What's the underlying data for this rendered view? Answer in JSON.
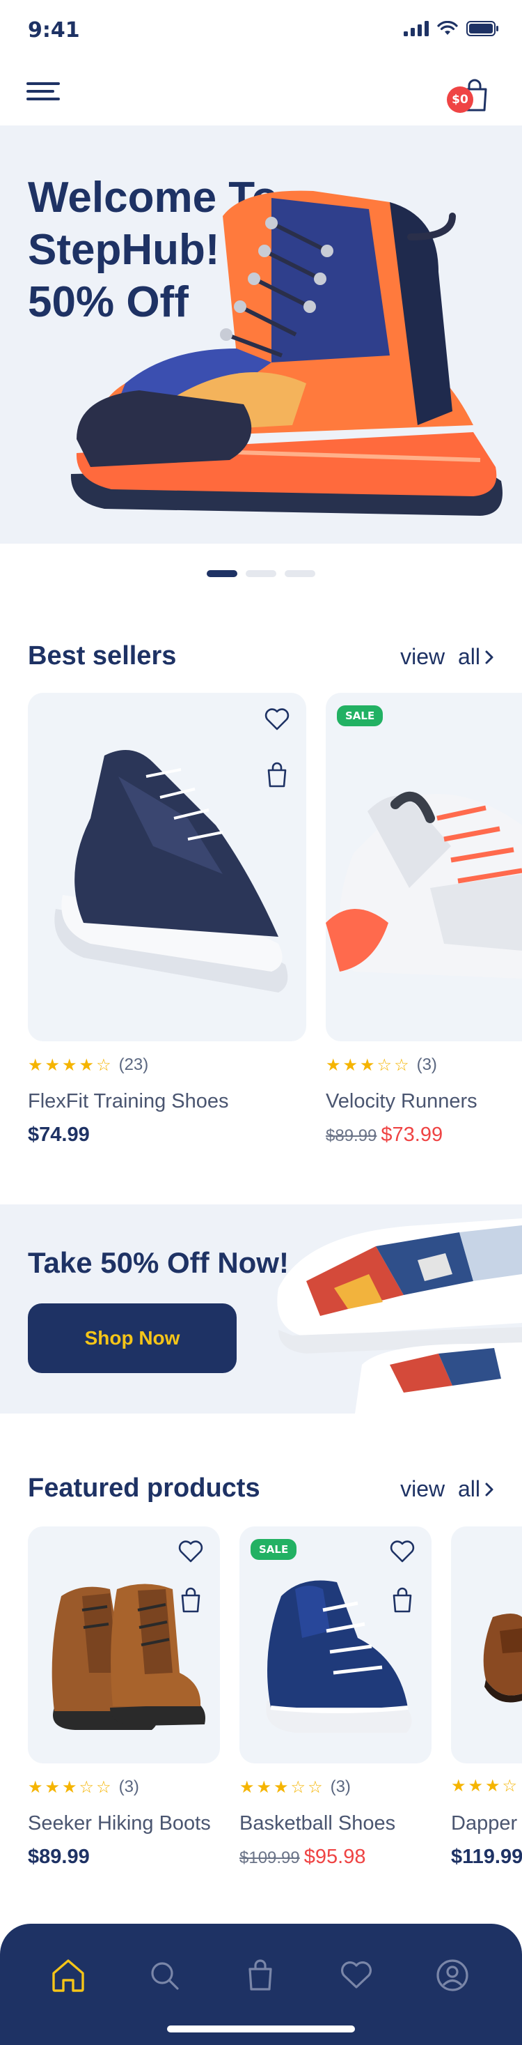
{
  "status_bar": {
    "time": "9:41"
  },
  "header": {
    "cart_count": "$0"
  },
  "hero": {
    "title_lines": [
      "Welcome To",
      "StepHub!",
      "50% Off"
    ],
    "slides": 3,
    "active_slide": 1
  },
  "best_sellers": {
    "title": "Best sellers",
    "view_all": "view all",
    "products": [
      {
        "name": "FlexFit Training Shoes",
        "price": "$74.99",
        "rating": 4,
        "rating_count": "(23)",
        "sale": false
      },
      {
        "name": "Velocity Runners",
        "old_price": "$89.99",
        "price": "$73.99",
        "rating": 3,
        "rating_count": "(3)",
        "sale": true,
        "sale_label": "SALE"
      }
    ]
  },
  "promo": {
    "title": "Take 50% Off Now!",
    "button": "Shop Now"
  },
  "featured": {
    "title": "Featured products",
    "view_all": "view all",
    "products": [
      {
        "name": "Seeker Hiking Boots",
        "price": "$89.99",
        "rating": 3,
        "rating_count": "(3)",
        "sale": false
      },
      {
        "name": "Basketball Shoes",
        "old_price": "$109.99",
        "price": "$95.98",
        "rating": 3,
        "rating_count": "(3)",
        "sale": true,
        "sale_label": "SALE"
      },
      {
        "name": "Dapper",
        "price": "$119.99",
        "rating": 3,
        "sale": false
      }
    ]
  },
  "tabbar": {
    "items": [
      {
        "icon": "home-icon",
        "active": true
      },
      {
        "icon": "search-icon",
        "active": false
      },
      {
        "icon": "bag-icon",
        "active": false
      },
      {
        "icon": "heart-icon",
        "active": false
      },
      {
        "icon": "profile-icon",
        "active": false
      }
    ]
  },
  "colors": {
    "navy": "#1e3264",
    "accent_yellow": "#f5c518",
    "sale_green": "#22b163",
    "price_red": "#ef4444",
    "card_bg": "#f0f4f9"
  }
}
